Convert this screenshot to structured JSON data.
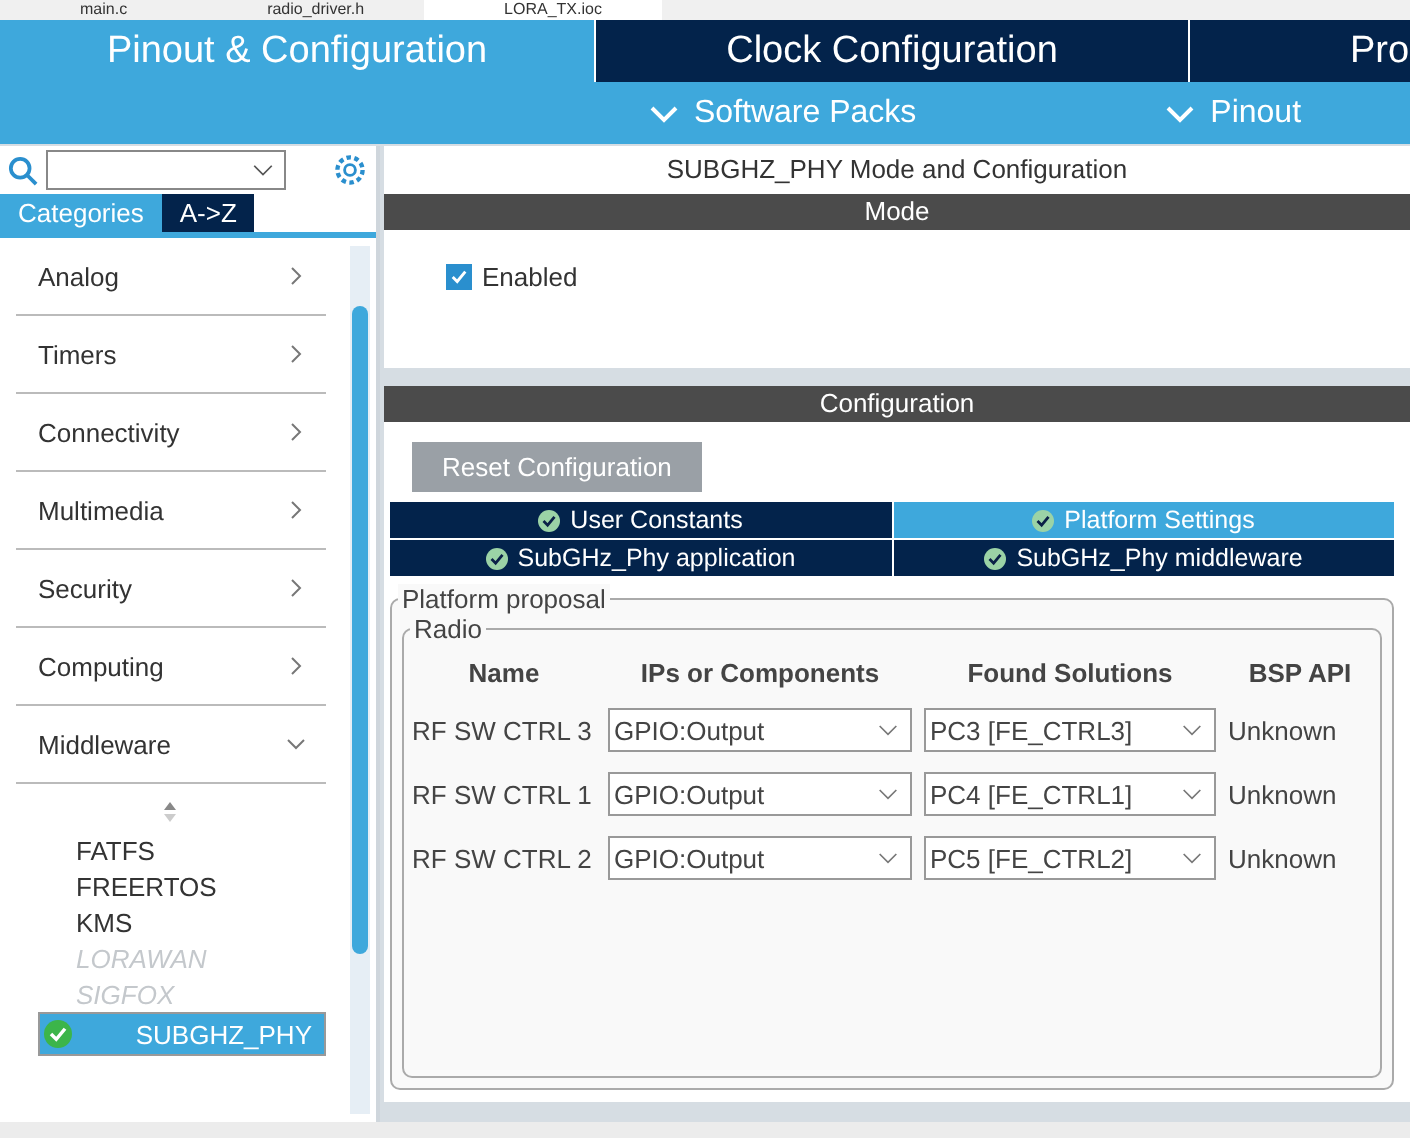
{
  "editor_tabs": [
    {
      "label": "main.c",
      "selected": false
    },
    {
      "label": "radio_driver.h",
      "selected": false
    },
    {
      "label": "LORA_TX.ioc",
      "selected": true
    }
  ],
  "main_tabs": [
    {
      "label": "Pinout & Configuration",
      "selected": true
    },
    {
      "label": "Clock Configuration",
      "selected": false
    },
    {
      "label": "Pro",
      "selected": false
    }
  ],
  "sub_menus": [
    "Software Packs",
    "Pinout"
  ],
  "sidebar": {
    "category_tabs": [
      {
        "label": "Categories",
        "selected": true
      },
      {
        "label": "A->Z",
        "selected": false
      }
    ],
    "categories": [
      {
        "label": "Analog",
        "expanded": false
      },
      {
        "label": "Timers",
        "expanded": false
      },
      {
        "label": "Connectivity",
        "expanded": false
      },
      {
        "label": "Multimedia",
        "expanded": false
      },
      {
        "label": "Security",
        "expanded": false
      },
      {
        "label": "Computing",
        "expanded": false
      },
      {
        "label": "Middleware",
        "expanded": true,
        "children": [
          {
            "label": "FATFS",
            "disabled": false,
            "selected": false,
            "checked": false
          },
          {
            "label": "FREERTOS",
            "disabled": false,
            "selected": false,
            "checked": false
          },
          {
            "label": "KMS",
            "disabled": false,
            "selected": false,
            "checked": false
          },
          {
            "label": "LORAWAN",
            "disabled": true,
            "selected": false,
            "checked": false
          },
          {
            "label": "SIGFOX",
            "disabled": true,
            "selected": false,
            "checked": false
          },
          {
            "label": "SUBGHZ_PHY",
            "disabled": false,
            "selected": true,
            "checked": true
          }
        ]
      }
    ]
  },
  "panel": {
    "title": "SUBGHZ_PHY Mode and Configuration",
    "mode": {
      "heading": "Mode",
      "enabled": {
        "label": "Enabled",
        "checked": true
      }
    },
    "configuration": {
      "heading": "Configuration",
      "reset_button": "Reset Configuration",
      "tabs": [
        {
          "label": "User Constants",
          "selected": false
        },
        {
          "label": "Platform Settings",
          "selected": true
        },
        {
          "label": "SubGHz_Phy application",
          "selected": false
        },
        {
          "label": "SubGHz_Phy middleware",
          "selected": false
        }
      ],
      "platform_proposal": {
        "legend": "Platform proposal",
        "radio": {
          "legend": "Radio",
          "columns": [
            "Name",
            "IPs or Components",
            "Found Solutions",
            "BSP API"
          ],
          "rows": [
            {
              "name": "RF SW CTRL 3",
              "component": "GPIO:Output",
              "solution": "PC3 [FE_CTRL3]",
              "bsp_api": "Unknown"
            },
            {
              "name": "RF SW CTRL 1",
              "component": "GPIO:Output",
              "solution": "PC4 [FE_CTRL1]",
              "bsp_api": "Unknown"
            },
            {
              "name": "RF SW CTRL 2",
              "component": "GPIO:Output",
              "solution": "PC5 [FE_CTRL2]",
              "bsp_api": "Unknown"
            }
          ]
        }
      }
    }
  }
}
